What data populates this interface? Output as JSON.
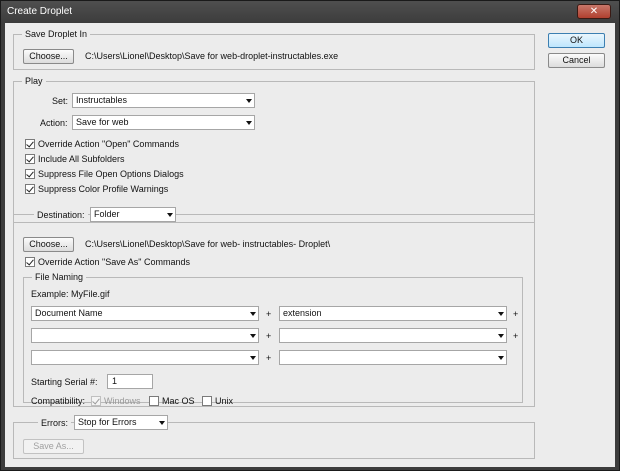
{
  "window": {
    "title": "Create Droplet",
    "close_label": "✕"
  },
  "dialog_buttons": {
    "ok": "OK",
    "cancel": "Cancel"
  },
  "save_droplet": {
    "group_label": "Save Droplet In",
    "choose_label": "Choose...",
    "path": "C:\\Users\\Lionel\\Desktop\\Save for web-droplet-instructables.exe"
  },
  "play": {
    "group_label": "Play",
    "set_label": "Set:",
    "set_value": "Instructables",
    "action_label": "Action:",
    "action_value": "Save for web",
    "options": [
      {
        "label": "Override Action \"Open\" Commands",
        "checked": true
      },
      {
        "label": "Include All Subfolders",
        "checked": true
      },
      {
        "label": "Suppress File Open Options Dialogs",
        "checked": true
      },
      {
        "label": "Suppress Color Profile Warnings",
        "checked": true
      }
    ]
  },
  "destination": {
    "label": "Destination:",
    "value": "Folder",
    "choose_label": "Choose...",
    "path": "C:\\Users\\Lionel\\Desktop\\Save for web- instructables- Droplet\\",
    "override_label": "Override Action \"Save As\" Commands",
    "override_checked": true
  },
  "file_naming": {
    "group_label": "File Naming",
    "example": "Example: MyFile.gif",
    "rows": [
      {
        "left": "Document Name",
        "right": "extension"
      },
      {
        "left": "",
        "right": ""
      },
      {
        "left": "",
        "right": ""
      }
    ],
    "plus": "+",
    "serial_label": "Starting Serial #:",
    "serial_value": "1",
    "compat_label": "Compatibility:",
    "compat": [
      {
        "label": "Windows",
        "checked": true,
        "disabled": true
      },
      {
        "label": "Mac OS",
        "checked": false,
        "disabled": false
      },
      {
        "label": "Unix",
        "checked": false,
        "disabled": false
      }
    ]
  },
  "errors": {
    "label": "Errors:",
    "value": "Stop for Errors",
    "save_as_label": "Save As..."
  }
}
